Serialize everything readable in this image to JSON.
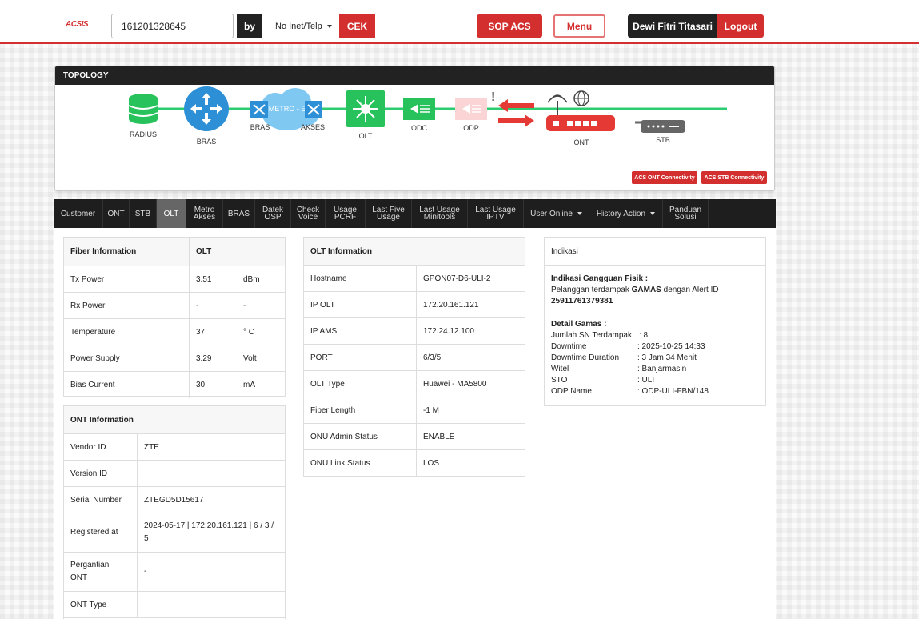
{
  "header": {
    "logo": "ACSIS",
    "search_value": "161201328645",
    "by_label": "by",
    "by_select": "No Inet/Telp",
    "cek_label": "CEK",
    "sop_label": "SOP ACS",
    "menu_label": "Menu",
    "user_name": "Dewi Fitri Titasari",
    "logout_label": "Logout"
  },
  "topology": {
    "title": "TOPOLOGY",
    "nodes": {
      "radius": "RADIUS",
      "bras1": "BRAS",
      "bras2": "BRAS",
      "metro": "METRO - E",
      "akses": "AKSES",
      "olt": "OLT",
      "odc": "ODC",
      "odp": "ODP",
      "ont": "ONT",
      "stb": "STB"
    },
    "acs_ont_label": "ACS ONT Connectivity",
    "acs_stb_label": "ACS STB Connectivity",
    "colors": {
      "line": "#2ecc71",
      "alert": "#e53935",
      "bras": "#2d8fd6",
      "olt": "#27c25c"
    }
  },
  "nav": {
    "tabs": [
      {
        "label": "Customer"
      },
      {
        "label": "ONT"
      },
      {
        "label": "STB"
      },
      {
        "label": "OLT",
        "active": true
      },
      {
        "label": "Metro Akses"
      },
      {
        "label": "BRAS"
      },
      {
        "label": "Datek OSP"
      },
      {
        "label": "Check Voice"
      },
      {
        "label": "Usage PCRF"
      },
      {
        "label": "Last Five Usage"
      },
      {
        "label": "Last Usage Minitools"
      },
      {
        "label": "Last Usage IPTV"
      },
      {
        "label": "User Online",
        "dropdown": true
      },
      {
        "label": "History Action",
        "dropdown": true
      },
      {
        "label": "Panduan Solusi"
      }
    ]
  },
  "fiber": {
    "title": "Fiber Information",
    "col": "OLT",
    "rows": [
      {
        "label": "Tx Power",
        "value": "3.51",
        "unit": "dBm"
      },
      {
        "label": "Rx Power",
        "value": "-",
        "unit": "-"
      },
      {
        "label": "Temperature",
        "value": "37",
        "unit": "° C"
      },
      {
        "label": "Power Supply",
        "value": "3.29",
        "unit": "Volt"
      },
      {
        "label": "Bias Current",
        "value": "30",
        "unit": "mA"
      }
    ]
  },
  "ont": {
    "title": "ONT Information",
    "rows": [
      {
        "label": "Vendor ID",
        "value": "ZTE"
      },
      {
        "label": "Version ID",
        "value": ""
      },
      {
        "label": "Serial Number",
        "value": "ZTEGD5D15617"
      },
      {
        "label": "Registered at",
        "value": "2024-05-17 | 172.20.161.121 | 6 / 3 / 5"
      },
      {
        "label": "Pergantian ONT",
        "value": "-"
      },
      {
        "label": "ONT Type",
        "value": ""
      }
    ]
  },
  "olt_info": {
    "title": "OLT Information",
    "rows": [
      {
        "label": "Hostname",
        "value": "GPON07-D6-ULI-2"
      },
      {
        "label": "IP OLT",
        "value": "172.20.161.121"
      },
      {
        "label": "IP AMS",
        "value": "172.24.12.100"
      },
      {
        "label": "PORT",
        "value": "6/3/5"
      },
      {
        "label": "OLT Type",
        "value": "Huawei - MA5800"
      },
      {
        "label": "Fiber Length",
        "value": "-1 M"
      },
      {
        "label": "ONU Admin Status",
        "value": "ENABLE"
      },
      {
        "label": "ONU Link Status",
        "value": "LOS"
      }
    ]
  },
  "indikasi": {
    "title": "Indikasi",
    "heading": "Indikasi Gangguan Fisik :",
    "line_prefix": "Pelanggan terdampak ",
    "line_bold": "GAMAS",
    "line_suffix": " dengan Alert ID",
    "alert_id": "25911761379381",
    "detail_heading": "Detail Gamas :",
    "details": [
      {
        "k": "Jumlah SN Terdampak",
        "v": ": 8"
      },
      {
        "k": "Downtime",
        "v": ": 2025-10-25 14:33"
      },
      {
        "k": "Downtime Duration",
        "v": ": 3 Jam 34 Menit"
      },
      {
        "k": "Witel",
        "v": ": Banjarmasin"
      },
      {
        "k": "STO",
        "v": ": ULI"
      },
      {
        "k": "ODP Name",
        "v": ": ODP-ULI-FBN/148"
      }
    ]
  }
}
